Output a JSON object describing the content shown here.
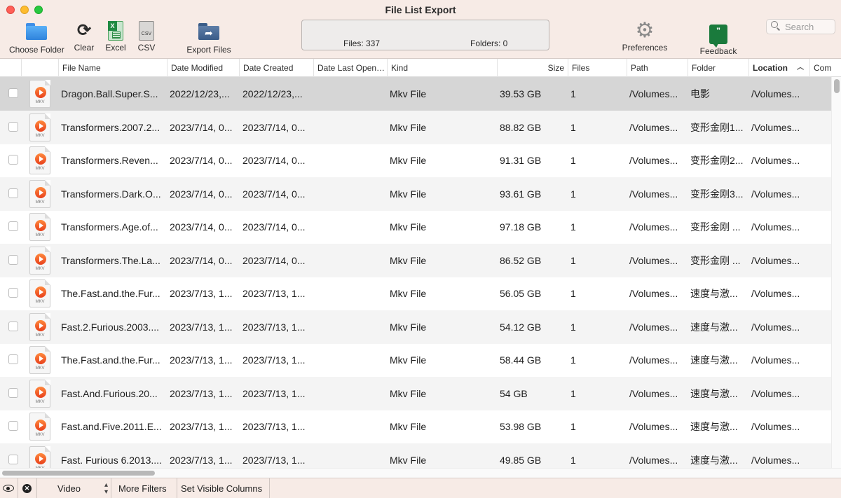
{
  "window": {
    "title": "File List Export"
  },
  "toolbar": {
    "choose_folder": "Choose Folder",
    "clear": "Clear",
    "excel": "Excel",
    "csv": "CSV",
    "export_files": "Export Files",
    "preferences": "Preferences",
    "feedback": "Feedback",
    "excel_icon_text": "X",
    "csv_icon_text": "CSV",
    "feedback_icon_text": "”"
  },
  "status": {
    "files": "Files: 337",
    "folders": "Folders: 0"
  },
  "search": {
    "placeholder": "Search"
  },
  "columns": {
    "file_name": "File Name",
    "date_modified": "Date Modified",
    "date_created": "Date Created",
    "date_last_opened": "Date Last Open…",
    "kind": "Kind",
    "size": "Size",
    "files": "Files",
    "path": "Path",
    "folder": "Folder",
    "location": "Location",
    "comments": "Com"
  },
  "file_icon_label": "MKV",
  "rows": [
    {
      "name": "Dragon.Ball.Super.S...",
      "modified": "2022/12/23,...",
      "created": "2022/12/23,...",
      "last_opened": "",
      "kind": "Mkv File",
      "size": "39.53 GB",
      "files": "1",
      "path": "/Volumes...",
      "folder": "电影",
      "location": "/Volumes..."
    },
    {
      "name": "Transformers.2007.2...",
      "modified": "2023/7/14, 0...",
      "created": "2023/7/14, 0...",
      "last_opened": "",
      "kind": "Mkv File",
      "size": "88.82 GB",
      "files": "1",
      "path": "/Volumes...",
      "folder": "变形金刚1...",
      "location": "/Volumes..."
    },
    {
      "name": "Transformers.Reven...",
      "modified": "2023/7/14, 0...",
      "created": "2023/7/14, 0...",
      "last_opened": "",
      "kind": "Mkv File",
      "size": "91.31 GB",
      "files": "1",
      "path": "/Volumes...",
      "folder": "变形金刚2...",
      "location": "/Volumes..."
    },
    {
      "name": "Transformers.Dark.O...",
      "modified": "2023/7/14, 0...",
      "created": "2023/7/14, 0...",
      "last_opened": "",
      "kind": "Mkv File",
      "size": "93.61 GB",
      "files": "1",
      "path": "/Volumes...",
      "folder": "变形金刚3...",
      "location": "/Volumes..."
    },
    {
      "name": "Transformers.Age.of...",
      "modified": "2023/7/14, 0...",
      "created": "2023/7/14, 0...",
      "last_opened": "",
      "kind": "Mkv File",
      "size": "97.18 GB",
      "files": "1",
      "path": "/Volumes...",
      "folder": "变形金刚 ...",
      "location": "/Volumes..."
    },
    {
      "name": "Transformers.The.La...",
      "modified": "2023/7/14, 0...",
      "created": "2023/7/14, 0...",
      "last_opened": "",
      "kind": "Mkv File",
      "size": "86.52 GB",
      "files": "1",
      "path": "/Volumes...",
      "folder": "变形金刚 ...",
      "location": "/Volumes..."
    },
    {
      "name": "The.Fast.and.the.Fur...",
      "modified": "2023/7/13, 1...",
      "created": "2023/7/13, 1...",
      "last_opened": "",
      "kind": "Mkv File",
      "size": "56.05 GB",
      "files": "1",
      "path": "/Volumes...",
      "folder": "速度与激...",
      "location": "/Volumes..."
    },
    {
      "name": "Fast.2.Furious.2003....",
      "modified": "2023/7/13, 1...",
      "created": "2023/7/13, 1...",
      "last_opened": "",
      "kind": "Mkv File",
      "size": "54.12 GB",
      "files": "1",
      "path": "/Volumes...",
      "folder": "速度与激...",
      "location": "/Volumes..."
    },
    {
      "name": "The.Fast.and.the.Fur...",
      "modified": "2023/7/13, 1...",
      "created": "2023/7/13, 1...",
      "last_opened": "",
      "kind": "Mkv File",
      "size": "58.44 GB",
      "files": "1",
      "path": "/Volumes...",
      "folder": "速度与激...",
      "location": "/Volumes..."
    },
    {
      "name": "Fast.And.Furious.20...",
      "modified": "2023/7/13, 1...",
      "created": "2023/7/13, 1...",
      "last_opened": "",
      "kind": "Mkv File",
      "size": "54 GB",
      "files": "1",
      "path": "/Volumes...",
      "folder": "速度与激...",
      "location": "/Volumes..."
    },
    {
      "name": "Fast.and.Five.2011.E...",
      "modified": "2023/7/13, 1...",
      "created": "2023/7/13, 1...",
      "last_opened": "",
      "kind": "Mkv File",
      "size": "53.98 GB",
      "files": "1",
      "path": "/Volumes...",
      "folder": "速度与激...",
      "location": "/Volumes..."
    },
    {
      "name": "Fast. Furious 6.2013....",
      "modified": "2023/7/13, 1...",
      "created": "2023/7/13, 1...",
      "last_opened": "",
      "kind": "Mkv File",
      "size": "49.85 GB",
      "files": "1",
      "path": "/Volumes...",
      "folder": "速度与激...",
      "location": "/Volumes..."
    }
  ],
  "bottombar": {
    "filter_value": "Video",
    "more_filters": "More Filters",
    "set_visible_columns": "Set Visible Columns",
    "clear_filter_glyph": "✕"
  }
}
